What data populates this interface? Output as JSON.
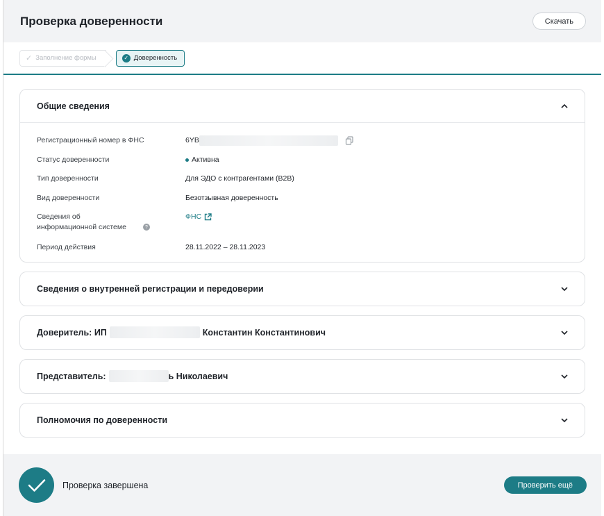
{
  "header": {
    "title": "Проверка доверенности",
    "download_label": "Скачать"
  },
  "steps": [
    {
      "label": "Заполнение формы",
      "state": "done"
    },
    {
      "label": "Доверенность",
      "state": "active"
    }
  ],
  "general": {
    "title": "Общие сведения",
    "rows": {
      "reg_number": {
        "label": "Регистрационный номер в ФНС",
        "value": "6YB"
      },
      "status": {
        "label": "Статус доверенности",
        "value": "Активна"
      },
      "type": {
        "label": "Тип доверенности",
        "value": "Для ЭДО с контрагентами (B2B)"
      },
      "kind": {
        "label": "Вид доверенности",
        "value": "Безотзывная доверенность"
      },
      "info_system": {
        "label": "Сведения об информационной системе",
        "value": "ФНС"
      },
      "period": {
        "label": "Период действия",
        "value": "28.11.2022 – 28.11.2023"
      }
    }
  },
  "sections": {
    "internal": {
      "title": "Сведения о внутренней регистрации и передоверии"
    },
    "principal": {
      "prefix": "Доверитель: ИП",
      "suffix": "Константин Константинович"
    },
    "representative": {
      "prefix": "Представитель:",
      "suffix": "ь Николаевич"
    },
    "powers": {
      "title": "Полномочия по доверенности"
    }
  },
  "footer": {
    "status": "Проверка завершена",
    "recheck_label": "Проверить ещё"
  },
  "colors": {
    "accent": "#1d7c86",
    "header_bg": "#f2f3f5"
  }
}
